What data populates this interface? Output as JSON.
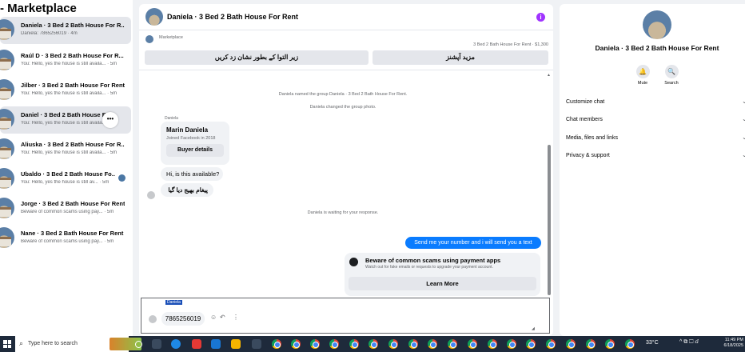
{
  "sidebar": {
    "title": "Marketplace",
    "title_prefix": "-",
    "conversations": [
      {
        "name": "Daniela · 3 Bed 2 Bath House For R...",
        "preview": "Daniela: 7865256019 · 4m",
        "selected": true
      },
      {
        "name": "Raúl D · 3 Bed 2 Bath House For R...",
        "preview": "You: Hello, yes the house is still availa... · 5m"
      },
      {
        "name": "Jilber · 3 Bed 2 Bath House For Rent",
        "preview": "You: Hello, yes the house is still availa... · 5m"
      },
      {
        "name": "Daniel · 3 Bed 2 Bath House Fo...",
        "preview": "You: Hello, yes the house is still availa... · 5m",
        "hovered": true
      },
      {
        "name": "Aliuska · 3 Bed 2 Bath House For R...",
        "preview": "You: Hello, yes the house is still availa... · 5m"
      },
      {
        "name": "Ubaldo · 3 Bed 2 Bath House Fo...",
        "preview": "You: Hello, yes the house is still av... · 5m"
      },
      {
        "name": "Jorge · 3 Bed 2 Bath House For Rent",
        "preview": "Beware of common scams using pay... · 5m"
      },
      {
        "name": "Nane · 3 Bed 2 Bath House For Rent",
        "preview": "Beware of common scams using pay... · 5m"
      }
    ],
    "more_glyph": "•••"
  },
  "chat": {
    "title": "Daniela · 3 Bed 2 Bath House For Rent",
    "info_glyph": "i",
    "marketplace": {
      "label": "Marketplace",
      "listing": "3 Bed 2 Bath House For Rent · $1,300",
      "button_left": "زیر التوا کے بطور نشان زد کریں",
      "button_right": "مزید آپشنز"
    },
    "system_messages": [
      "Daniela named the group Daniela · 3 Bed 2 Bath House For Rent.",
      "Daniela changed the group photo.",
      "Daniela is waiting for your response."
    ],
    "sender_label": "Daniela",
    "profile_card": {
      "name": "Marin Daniela",
      "joined": "Joined Facebook in 2018",
      "button": "Buyer details"
    },
    "incoming": [
      "Hi, is this available?",
      "پیغام بھیج دیا گیا"
    ],
    "outgoing": "Send me your number and i will send you a text",
    "scam_notice": {
      "title": "Beware of common scams using payment apps",
      "desc": "Watch out for fake emails or requests to upgrade your payment account.",
      "button": "Learn More"
    },
    "composer": {
      "selected_label": "Daniela",
      "message": "7865256019",
      "emoji_glyph": "☺",
      "reply_glyph": "↶",
      "more_glyph": "⋮",
      "resize_glyph": "◢",
      "scroll_up_glyph": "▲"
    }
  },
  "info": {
    "title": "Daniela · 3 Bed 2 Bath House For Rent",
    "actions": [
      {
        "label": "Mute",
        "icon": "bell-icon",
        "glyph": "🔔"
      },
      {
        "label": "Search",
        "icon": "search-icon",
        "glyph": "🔍"
      }
    ],
    "sections": [
      "Customize chat",
      "Chat members",
      "Media, files and links",
      "Privacy & support"
    ],
    "chevron": "⌄"
  },
  "taskbar": {
    "search_placeholder": "Type here to search",
    "search_glyph": "⌕",
    "weather": "33°C",
    "tray": "^ ⧉ ☐ ⅆ",
    "time": "11:49 PM",
    "date": "6/18/2025",
    "accent": "#0a7cff"
  }
}
